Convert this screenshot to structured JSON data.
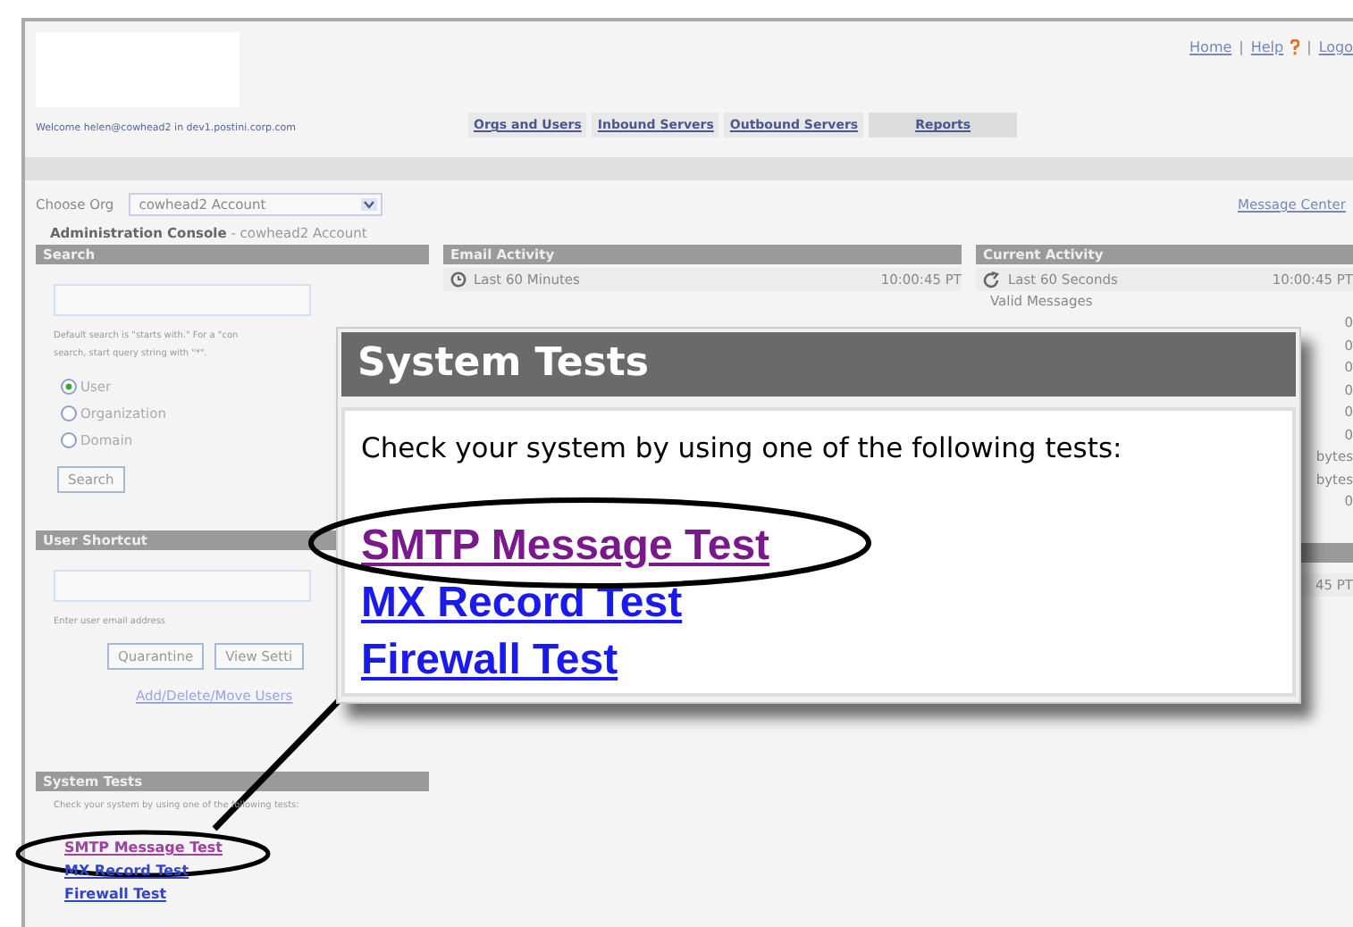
{
  "header": {
    "links": [
      "Home",
      "Help",
      "Logo"
    ],
    "separators": [
      "|",
      "|"
    ],
    "welcome": "Welcome helen@cowhead2 in dev1.postini.corp.com"
  },
  "tabs": [
    {
      "label": "Orgs and Users",
      "selected": false
    },
    {
      "label": "Inbound Servers",
      "selected": false
    },
    {
      "label": "Outbound Servers",
      "selected": false
    },
    {
      "label": "Reports",
      "selected": true
    }
  ],
  "org_bar": {
    "label": "Choose Org",
    "value": "cowhead2 Account",
    "message_center": "Message Center"
  },
  "console_title": {
    "title": "Administration Console",
    "account": "- cowhead2 Account"
  },
  "search": {
    "title": "Search",
    "hint": [
      "Default search is \"starts with.\" For a \"con",
      "search, start query string with \"*\"."
    ],
    "options": [
      {
        "label": "User",
        "selected": true
      },
      {
        "label": "Organization",
        "selected": false
      },
      {
        "label": "Domain",
        "selected": false
      }
    ],
    "button": "Search"
  },
  "user_shortcut": {
    "title": "User Shortcut",
    "hint": "Enter user email address",
    "buttons": [
      "Quarantine",
      "View Setti"
    ],
    "link": "Add/Delete/Move Users"
  },
  "system_tests": {
    "title": "System Tests",
    "text": "Check your system by using one of the following tests:",
    "links": [
      {
        "label": "SMTP Message Test",
        "visited": true
      },
      {
        "label": "MX Record Test",
        "visited": false
      },
      {
        "label": "Firewall Test",
        "visited": false
      }
    ]
  },
  "email_activity": {
    "title": "Email Activity",
    "period": "Last 60 Minutes",
    "time": "10:00:45 PT"
  },
  "current_activity": {
    "title": "Current Activity",
    "period": "Last 60 Seconds",
    "time": "10:00:45 PT",
    "first_row": "Valid Messages",
    "values": [
      "0",
      "0",
      "0",
      "0",
      "0",
      "0",
      "bytes",
      "bytes",
      "0"
    ],
    "second_time": "45 PT"
  },
  "callout": {
    "title": "System Tests",
    "text": "Check your system by using one of the following tests:",
    "links": [
      {
        "label": "SMTP Message Test",
        "visited": true
      },
      {
        "label": "MX Record Test",
        "visited": false
      },
      {
        "label": "Firewall Test",
        "visited": false
      }
    ]
  }
}
